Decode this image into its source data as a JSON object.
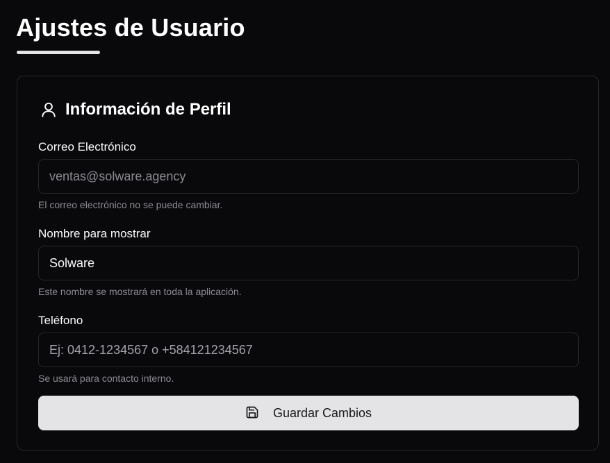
{
  "page": {
    "title": "Ajustes de Usuario"
  },
  "profile": {
    "title": "Información de Perfil",
    "icon": "user-icon",
    "email": {
      "label": "Correo Electrónico",
      "value": "ventas@solware.agency",
      "hint": "El correo electrónico no se puede cambiar."
    },
    "display_name": {
      "label": "Nombre para mostrar",
      "value": "Solware",
      "hint": "Este nombre se mostrará en toda la aplicación."
    },
    "phone": {
      "label": "Teléfono",
      "value": "",
      "placeholder": "Ej: 0412-1234567 o +584121234567",
      "hint": "Se usará para contacto interno."
    },
    "save_button": {
      "label": "Guardar Cambios",
      "icon": "save-icon"
    }
  },
  "colors": {
    "background": "#09090b",
    "card_border": "#27272a",
    "button_bg": "#e4e4e7",
    "hint_text": "#8b8b92"
  }
}
